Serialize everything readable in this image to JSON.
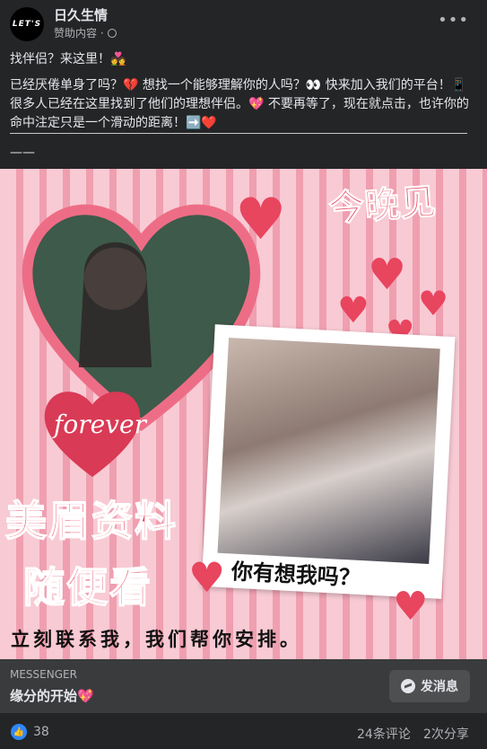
{
  "post": {
    "avatar_text": "LET'S",
    "page_name": "日久生情",
    "sponsored_label": "赞助内容 ·",
    "more_icon": "more-horizontal-icon",
    "text_line1": "找伴侣？来这里！💑",
    "text_para2": "已经厌倦单身了吗？💔 想找一个能够理解你的人吗？👀 快来加入我们的平台！📱很多人已经在这里找到了他们的理想伴侣。💖 不要再等了，现在就点击，也许你的命中注定只是一个滑动的距离！➡️❤️",
    "dash": "——"
  },
  "creative": {
    "headline": "今晚见",
    "line1": "美眉资料",
    "line2": "随便看",
    "forever": "forever",
    "bubble": "你有想我吗？",
    "cta_line": "立刻联系我，我们帮你安排。"
  },
  "ad_bar": {
    "source": "MESSENGER",
    "headline": "缘分的开始💖",
    "button_label": "发消息"
  },
  "footer": {
    "likes": "38",
    "comments": "24条评论",
    "shares": "2次分享"
  },
  "colors": {
    "background": "#242526",
    "accent_pink": "#e8455f",
    "like_blue": "#2d88ff"
  }
}
